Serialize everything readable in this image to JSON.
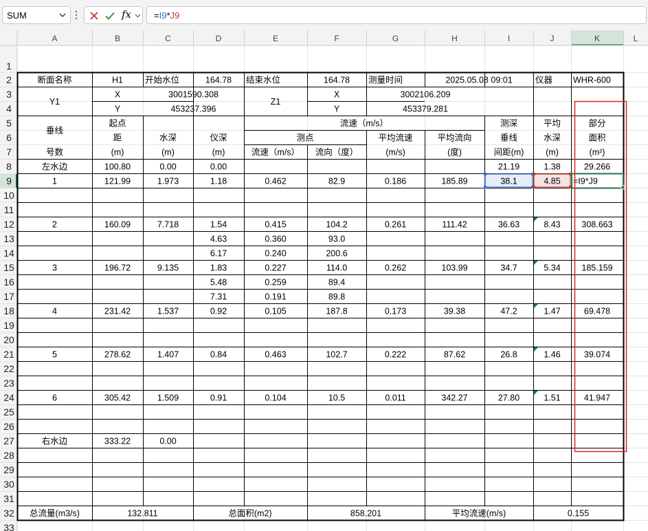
{
  "formula_bar": {
    "name_box": "SUM",
    "fx_label": "fx",
    "formula": {
      "eq": "=",
      "ref1": "I9",
      "op": "*",
      "ref2": "J9"
    },
    "colors": {
      "ref1": "#2f6fd6",
      "ref2": "#c0392b"
    }
  },
  "sheet": {
    "columns": [
      "A",
      "B",
      "C",
      "D",
      "E",
      "F",
      "G",
      "H",
      "I",
      "J",
      "K",
      "L"
    ],
    "active_column": "K",
    "active_row": "9",
    "highlight_color": "#217346",
    "rows": [
      "1",
      "2",
      "3",
      "4",
      "5",
      "6",
      "7",
      "8",
      "9",
      "10",
      "11",
      "12",
      "13",
      "14",
      "15",
      "16",
      "17",
      "18",
      "19",
      "20",
      "21",
      "22",
      "23",
      "24",
      "25",
      "26",
      "27",
      "28",
      "29",
      "30",
      "31",
      "32",
      "33"
    ]
  },
  "cells": {
    "A2": "断面名称",
    "B2": "H1",
    "C2": "开始水位",
    "D2": "164.78",
    "E2": "结束水位",
    "F2": "164.78",
    "G2": "测量时间",
    "H2": "2025.05.08 09:01",
    "J2": "仪器",
    "K2": "WHR-600",
    "A3": "Y1",
    "B3": "X",
    "C3": "3001590.308",
    "E3": "Z1",
    "F3": "X",
    "G3": "3002106.209",
    "B4": "Y",
    "C4": "453237.396",
    "F4": "Y",
    "G4": "453379.281",
    "A5": "垂线",
    "B5": "起点",
    "C5": "水深",
    "D5": "仪深",
    "E5": "流速（m/s）",
    "I5": "测深",
    "J5": "平均",
    "K5": "部分",
    "B6": "距",
    "E6": "测点",
    "G6": "平均流速",
    "H6": "平均流向",
    "I6": "垂线",
    "J6": "水深",
    "K6": "面积",
    "A7": "号数",
    "B7": "(m)",
    "C7": "(m)",
    "D7": "(m)",
    "E7": "流速（m/s）",
    "F7": "流向（度）",
    "G7": "(m/s)",
    "H7": "(度)",
    "I7": "间距(m)",
    "J7": "(m)",
    "K7": "(m²)",
    "A8": "左水边",
    "B8": "100.80",
    "C8": "0.00",
    "D8": "0.00",
    "I8": "21.19",
    "J8": "1.38",
    "K8": "29.266",
    "A9": "1",
    "B9": "121.99",
    "C9": "1.973",
    "D9": "1.18",
    "E9": "0.462",
    "F9": "82.9",
    "G9": "0.186",
    "H9": "185.89",
    "I9": "38.1",
    "J9": "4.85",
    "K9": "=I9*J9",
    "A12": "2",
    "B12": "160.09",
    "C12": "7.718",
    "D12": "1.54",
    "E12": "0.415",
    "F12": "104.2",
    "G12": "0.261",
    "H12": "111.42",
    "I12": "36.63",
    "J12": "8.43",
    "K12": "308.663",
    "D13": "4.63",
    "E13": "0.360",
    "F13": "93.0",
    "D14": "6.17",
    "E14": "0.240",
    "F14": "200.6",
    "A15": "3",
    "B15": "196.72",
    "C15": "9.135",
    "D15": "1.83",
    "E15": "0.227",
    "F15": "114.0",
    "G15": "0.262",
    "H15": "103.99",
    "I15": "34.7",
    "J15": "5.34",
    "K15": "185.159",
    "D16": "5.48",
    "E16": "0.259",
    "F16": "89.4",
    "D17": "7.31",
    "E17": "0.191",
    "F17": "89.8",
    "A18": "4",
    "B18": "231.42",
    "C18": "1.537",
    "D18": "0.92",
    "E18": "0.105",
    "F18": "187.8",
    "G18": "0.173",
    "H18": "39.38",
    "I18": "47.2",
    "J18": "1.47",
    "K18": "69.478",
    "A21": "5",
    "B21": "278.62",
    "C21": "1.407",
    "D21": "0.84",
    "E21": "0.463",
    "F21": "102.7",
    "G21": "0.222",
    "H21": "87.62",
    "I21": "26.8",
    "J21": "1.46",
    "K21": "39.074",
    "A24": "6",
    "B24": "305.42",
    "C24": "1.509",
    "D24": "0.91",
    "E24": "0.104",
    "F24": "10.5",
    "G24": "0.011",
    "H24": "342.27",
    "I24": "27.80",
    "J24": "1.51",
    "K24": "41.947",
    "A27": "右水边",
    "B27": "333.22",
    "C27": "0.00",
    "A32": "总流量(m3/s)",
    "B32": "132.811",
    "D32": "总面积(m2)",
    "F32": "858.201",
    "H32": "平均流速(m/s)",
    "J32": "0.155"
  }
}
